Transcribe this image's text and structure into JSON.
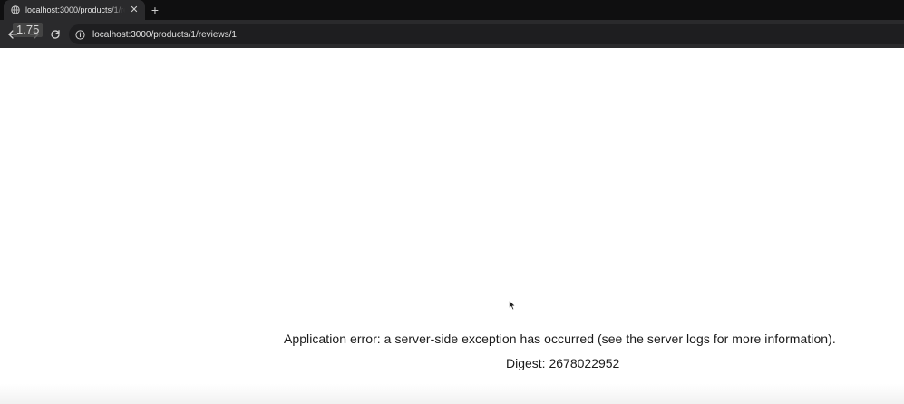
{
  "browser": {
    "tab": {
      "title": "localhost:3000/products/1/re",
      "favicon": "globe-icon",
      "close_icon": "close-icon"
    },
    "new_tab_icon": "plus-icon",
    "overlay_speed": "1.75",
    "toolbar": {
      "back_icon": "back-arrow-icon",
      "forward_icon": "forward-arrow-icon",
      "reload_icon": "reload-icon",
      "site_info_icon": "info-icon",
      "url": "localhost:3000/products/1/reviews/1"
    }
  },
  "page": {
    "error_message": "Application error: a server-side exception has occurred (see the server logs for more information).",
    "digest": "Digest: 2678022952"
  },
  "colors": {
    "tabstrip_bg": "#0f0f10",
    "toolbar_bg": "#2a2a2c",
    "omnibox_bg": "#1e1e20",
    "page_bg": "#ffffff",
    "text": "#1a1a1a"
  }
}
